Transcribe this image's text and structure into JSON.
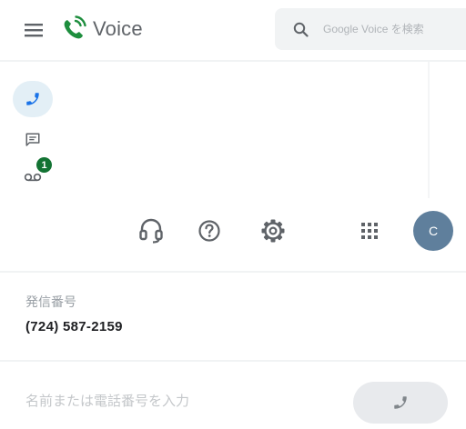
{
  "header": {
    "app_title": "Voice",
    "search_placeholder": "Google Voice を検索"
  },
  "sidebar": {
    "items": [
      {
        "id": "calls",
        "icon": "phone-icon",
        "selected": true
      },
      {
        "id": "messages",
        "icon": "message-icon"
      },
      {
        "id": "voicemail",
        "icon": "voicemail-icon",
        "badge": "1"
      }
    ]
  },
  "toolbar": {
    "icons": [
      "support-icon",
      "help-icon",
      "settings-icon",
      "apps-grid-icon"
    ],
    "avatar_initial": "C"
  },
  "caller_id": {
    "label": "発信番号",
    "number": "(724) 587-2159"
  },
  "dialer": {
    "placeholder": "名前または電話番号を入力"
  },
  "colors": {
    "brand_green": "#137333",
    "avatar": "#5f7f9c",
    "selected_nav": "#e3eff6",
    "search_bg": "#f1f3f4"
  }
}
